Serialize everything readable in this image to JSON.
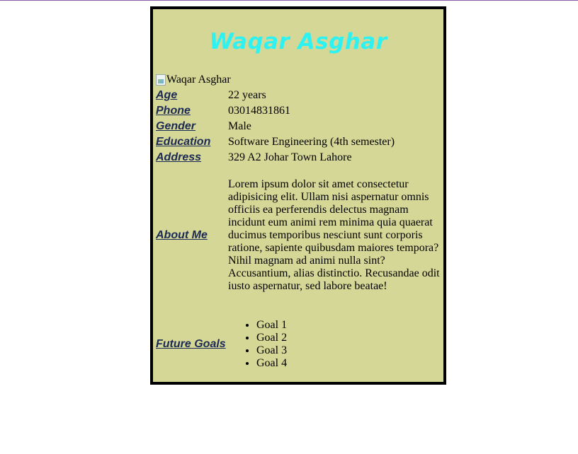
{
  "name": "Waqar Asghar",
  "photo_alt": "Waqar Asghar",
  "colors": {
    "card_bg": "#d5d797",
    "title": "#2ef2f2",
    "label": "#1b2a55",
    "border": "#000000"
  },
  "fields": {
    "age": {
      "label": "Age",
      "value": "22 years"
    },
    "phone": {
      "label": "Phone",
      "value": "03014831861"
    },
    "gender": {
      "label": "Gender",
      "value": "Male"
    },
    "education": {
      "label": "Education",
      "value": "Software Engineering (4th semester)"
    },
    "address": {
      "label": "Address",
      "value": "329 A2 Johar Town Lahore"
    },
    "about": {
      "label": "About Me",
      "value": "Lorem ipsum dolor sit amet consectetur adipisicing elit. Ullam nisi aspernatur omnis officiis ea perferendis delectus magnam incidunt eum animi rem minima quia quaerat ducimus temporibus nesciunt sunt corporis ratione, sapiente quibusdam maiores tempora? Nihil magnam ad animi nulla sint? Accusantium, alias distinctio. Recusandae odit iusto aspernatur, sed labore beatae!"
    },
    "goals": {
      "label": "Future Goals",
      "items": [
        "Goal 1",
        "Goal 2",
        "Goal 3",
        "Goal 4"
      ]
    }
  }
}
